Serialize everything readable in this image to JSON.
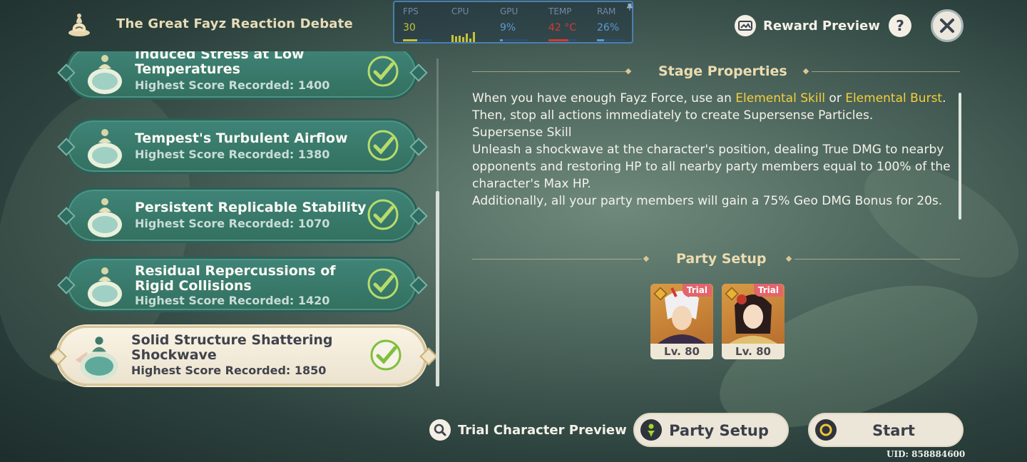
{
  "header": {
    "event_title": "The Great Fayz Reaction Debate",
    "event_icon": "fayz-jar-icon",
    "reward_preview_label": "Reward Preview",
    "help_label": "?"
  },
  "perf_overlay": {
    "fps_label": "FPS",
    "fps_value": "30",
    "fps_fraction": 0.5,
    "cpu_label": "CPU",
    "gpu_label": "GPU",
    "gpu_value": "9%",
    "gpu_fraction": 0.09,
    "temp_label": "TEMP",
    "temp_value": "42 °C",
    "temp_fraction": 0.7,
    "ram_label": "RAM",
    "ram_value": "26%",
    "ram_fraction": 0.26,
    "colors": {
      "fps": "#c6c238",
      "gpu": "#5d9ad0",
      "temp": "#d23a32",
      "ram": "#5d9ad0"
    }
  },
  "stages": [
    {
      "title": "Induced Stress at Low Temperatures",
      "score": "Highest Score Recorded: 1400",
      "completed": true,
      "selected": false
    },
    {
      "title": "Tempest's Turbulent Airflow",
      "score": "Highest Score Recorded: 1380",
      "completed": true,
      "selected": false
    },
    {
      "title": "Persistent Replicable Stability",
      "score": "Highest Score Recorded: 1070",
      "completed": true,
      "selected": false
    },
    {
      "title": "Residual Repercussions of Rigid Collisions",
      "score": "Highest Score Recorded: 1420",
      "completed": true,
      "selected": false
    },
    {
      "title": "Solid Structure Shattering Shockwave",
      "score": "Highest Score Recorded: 1850",
      "completed": true,
      "selected": true
    }
  ],
  "stage_properties": {
    "heading": "Stage Properties",
    "line1_pre": "When you have enough Fayz Force, use an ",
    "hl1": "Elemental Skill",
    "line1_mid": " or ",
    "hl2": "Elemental Burst",
    "line1_post": ". Then, stop all actions immediately to create Supersense Particles.",
    "skill_name": "Supersense Skill",
    "skill_desc": "Unleash a shockwave at the character's position, dealing True DMG to nearby opponents and restoring HP to all nearby party members equal to 100% of the character's Max HP.",
    "extra": "Additionally, all your party members will gain a 75% Geo DMG Bonus for 20s.",
    "highlight_color": "#f5cf3a"
  },
  "party_setup": {
    "heading": "Party Setup",
    "members": [
      {
        "level": "Lv. 80",
        "tag": "Trial",
        "element": "geo-icon"
      },
      {
        "level": "Lv. 80",
        "tag": "Trial",
        "element": "geo-icon"
      }
    ]
  },
  "footer": {
    "trial_preview_label": "Trial Character Preview",
    "party_setup_label": "Party Setup",
    "start_label": "Start",
    "uid": "UID: 858884600"
  }
}
